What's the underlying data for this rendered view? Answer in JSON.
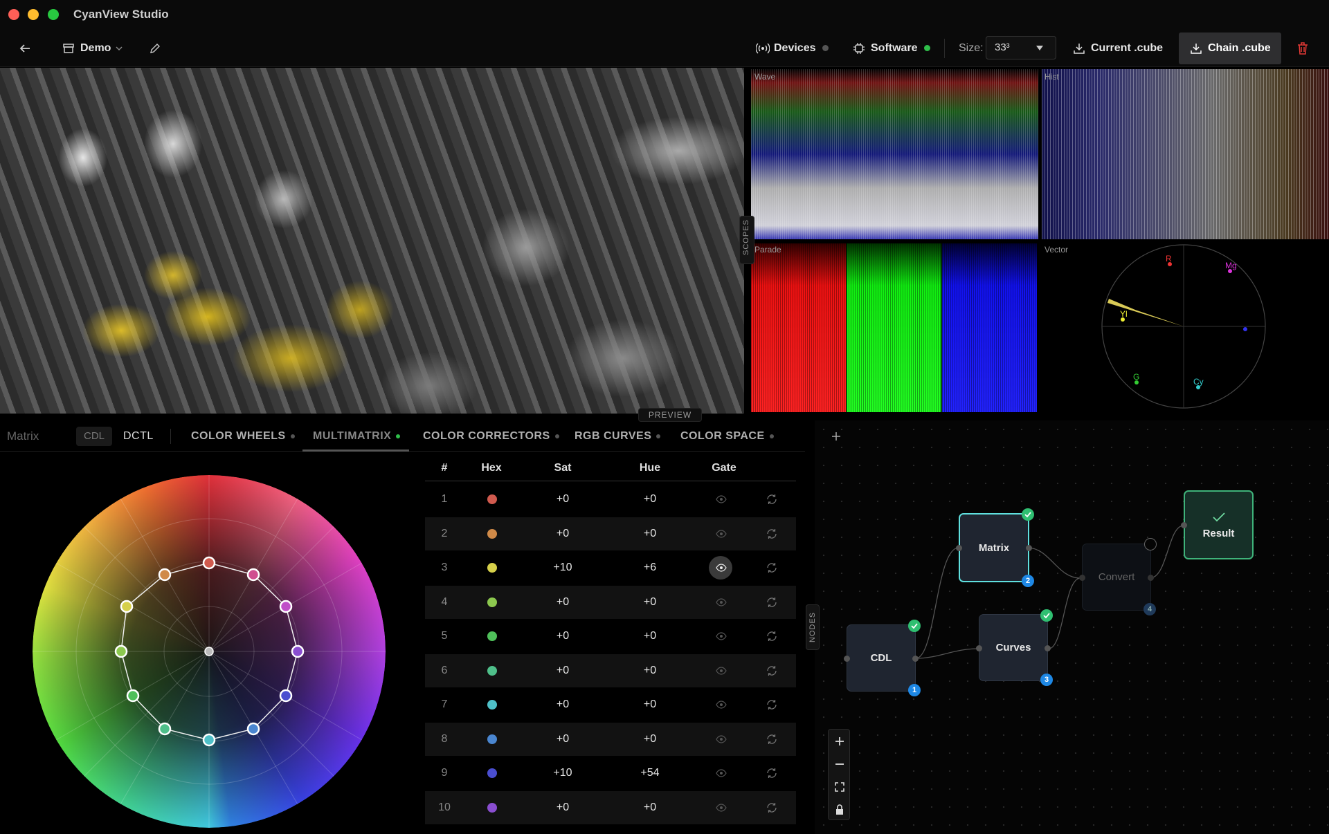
{
  "window": {
    "title": "CyanView Studio"
  },
  "toolbar": {
    "project_name": "Demo",
    "devices_label": "Devices",
    "software_label": "Software",
    "size_label": "Size:",
    "size_value": "33³",
    "current_cube_label": "Current .cube",
    "chain_cube_label": "Chain .cube"
  },
  "preview": {
    "label": "PREVIEW"
  },
  "scopes": {
    "handle_label": "SCOPES",
    "wave_label": "Wave",
    "hist_label": "Hist",
    "parade_label": "Parade",
    "vector_label": "Vector",
    "vector_targets": [
      "R",
      "Mg",
      "Yl",
      "G",
      "Cy"
    ]
  },
  "tabs": {
    "panel_title": "Matrix",
    "cdl": "CDL",
    "dctl": "DCTL",
    "items": [
      {
        "label": "COLOR WHEELS"
      },
      {
        "label": "MULTIMATRIX"
      },
      {
        "label": "COLOR CORRECTORS"
      },
      {
        "label": "RGB CURVES"
      },
      {
        "label": "COLOR SPACE"
      }
    ]
  },
  "table": {
    "headers": {
      "num": "#",
      "hex": "Hex",
      "sat": "Sat",
      "hue": "Hue",
      "gate": "Gate"
    },
    "rows": [
      {
        "num": "1",
        "color": "#d05a4e",
        "sat": "+0",
        "hue": "+0",
        "gate_active": false
      },
      {
        "num": "2",
        "color": "#d08a48",
        "sat": "+0",
        "hue": "+0",
        "gate_active": false
      },
      {
        "num": "3",
        "color": "#d6d04a",
        "sat": "+10",
        "hue": "+6",
        "gate_active": true
      },
      {
        "num": "4",
        "color": "#8cc84e",
        "sat": "+0",
        "hue": "+0",
        "gate_active": false
      },
      {
        "num": "5",
        "color": "#4fbf5a",
        "sat": "+0",
        "hue": "+0",
        "gate_active": false
      },
      {
        "num": "6",
        "color": "#4fbf8a",
        "sat": "+0",
        "hue": "+0",
        "gate_active": false
      },
      {
        "num": "7",
        "color": "#4fc0c8",
        "sat": "+0",
        "hue": "+0",
        "gate_active": false
      },
      {
        "num": "8",
        "color": "#4a86d0",
        "sat": "+0",
        "hue": "+0",
        "gate_active": false
      },
      {
        "num": "9",
        "color": "#4a4ed0",
        "sat": "+10",
        "hue": "+54",
        "gate_active": false
      },
      {
        "num": "10",
        "color": "#8a4ed0",
        "sat": "+0",
        "hue": "+0",
        "gate_active": false
      }
    ]
  },
  "nodes": {
    "handle_label": "NODES",
    "items": [
      {
        "label": "CDL",
        "index": "1"
      },
      {
        "label": "Matrix",
        "index": "2"
      },
      {
        "label": "Curves",
        "index": "3"
      },
      {
        "label": "Convert",
        "index": "4"
      },
      {
        "label": "Result"
      }
    ]
  },
  "colors": {
    "accent_cyan": "#5fe0df",
    "status_green": "#2fbf4a",
    "result_green": "#3fb37a",
    "badge_blue": "#1e88e5",
    "delete_red": "#e53935"
  }
}
